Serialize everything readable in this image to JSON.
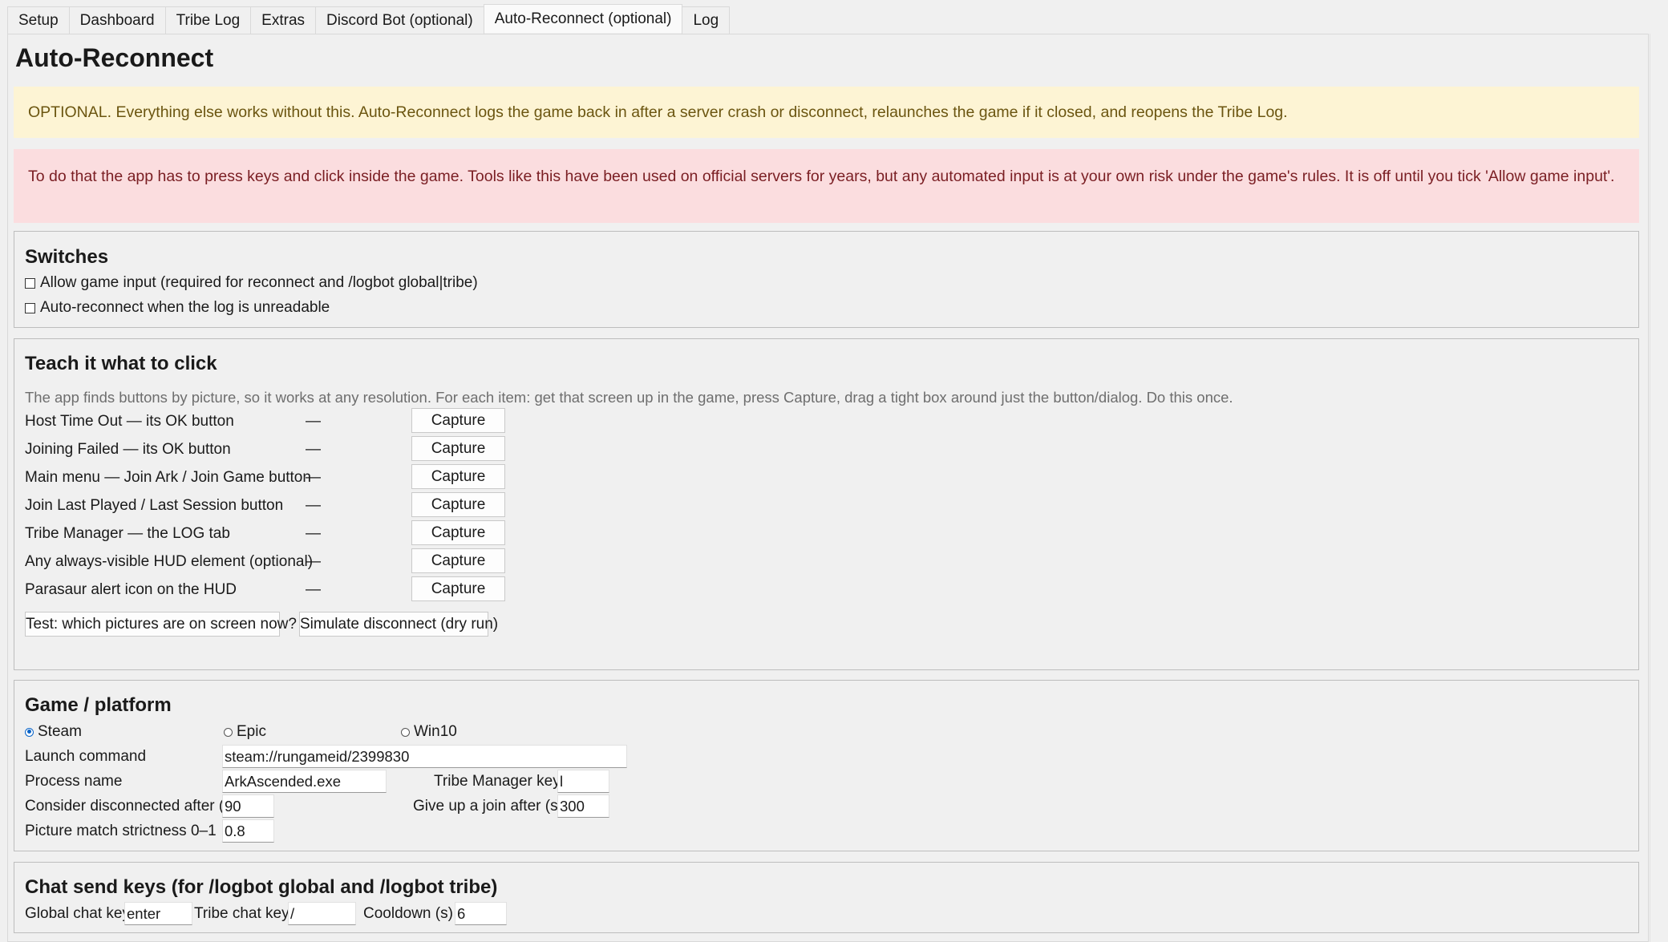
{
  "tabs": [
    {
      "label": "Setup"
    },
    {
      "label": "Dashboard"
    },
    {
      "label": "Tribe Log"
    },
    {
      "label": "Extras"
    },
    {
      "label": "Discord Bot (optional)"
    },
    {
      "label": "Auto-Reconnect (optional)"
    },
    {
      "label": "Log"
    }
  ],
  "page": {
    "title": "Auto-Reconnect",
    "notice": "OPTIONAL. Everything else works without this. Auto-Reconnect logs the game back in after a server crash or disconnect, relaunches the game if it closed, and reopens the Tribe Log.",
    "warning": "To do that the app has to press keys and click inside the game. Tools like this have been used on official servers for years, but any automated input is at your own risk under the game's rules. It is off until you tick 'Allow game input'."
  },
  "switches": {
    "title": "Switches",
    "allow_input": {
      "label": "Allow game input (required for reconnect and /logbot global|tribe)",
      "checked": false
    },
    "auto_reconnect": {
      "label": "Auto-reconnect when the log is unreadable",
      "checked": false
    }
  },
  "teach": {
    "title": "Teach it what to click",
    "hint": "The app finds buttons by picture, so it works at any resolution. For each item: get that screen up in the game, press Capture, drag a tight box around just the button/dialog. Do this once.",
    "items": [
      {
        "label": "Host Time Out — its OK button",
        "status": "—",
        "button": "Capture"
      },
      {
        "label": "Joining Failed — its OK button",
        "status": "—",
        "button": "Capture"
      },
      {
        "label": "Main menu — Join Ark / Join Game button",
        "status": "—",
        "button": "Capture"
      },
      {
        "label": "Join Last Played / Last Session button",
        "status": "—",
        "button": "Capture"
      },
      {
        "label": "Tribe Manager — the LOG tab",
        "status": "—",
        "button": "Capture"
      },
      {
        "label": "Any always-visible HUD element (optional)",
        "status": "—",
        "button": "Capture"
      },
      {
        "label": "Parasaur alert icon on the HUD",
        "status": "—",
        "button": "Capture"
      }
    ],
    "test_button": "Test: which pictures are on screen now?",
    "simulate_button": "Simulate disconnect (dry run)"
  },
  "platform": {
    "title": "Game / platform",
    "options": [
      "Steam",
      "Epic",
      "Win10"
    ],
    "selected": "Steam",
    "launch_command_label": "Launch command",
    "launch_command": "steam://rungameid/2399830",
    "process_name_label": "Process name",
    "process_name": "ArkAscended.exe",
    "tribe_manager_key_label": "Tribe Manager key",
    "tribe_manager_key": "l",
    "disconnected_after_label": "Consider disconnected after (s)",
    "disconnected_after": "90",
    "give_up_label": "Give up a join after (s)",
    "give_up": "300",
    "strictness_label": "Picture match strictness 0–1",
    "strictness": "0.8"
  },
  "chat": {
    "title": "Chat send keys (for /logbot global and /logbot tribe)",
    "global_label": "Global chat key",
    "global_key": "enter",
    "tribe_label": "Tribe chat key",
    "tribe_key": "/",
    "cooldown_label": "Cooldown (s)",
    "cooldown": "6"
  },
  "colors": {
    "notice_bg": "#fdf4d4",
    "warning_bg": "#fbdddf",
    "radio_accent": "#0a64c8"
  }
}
